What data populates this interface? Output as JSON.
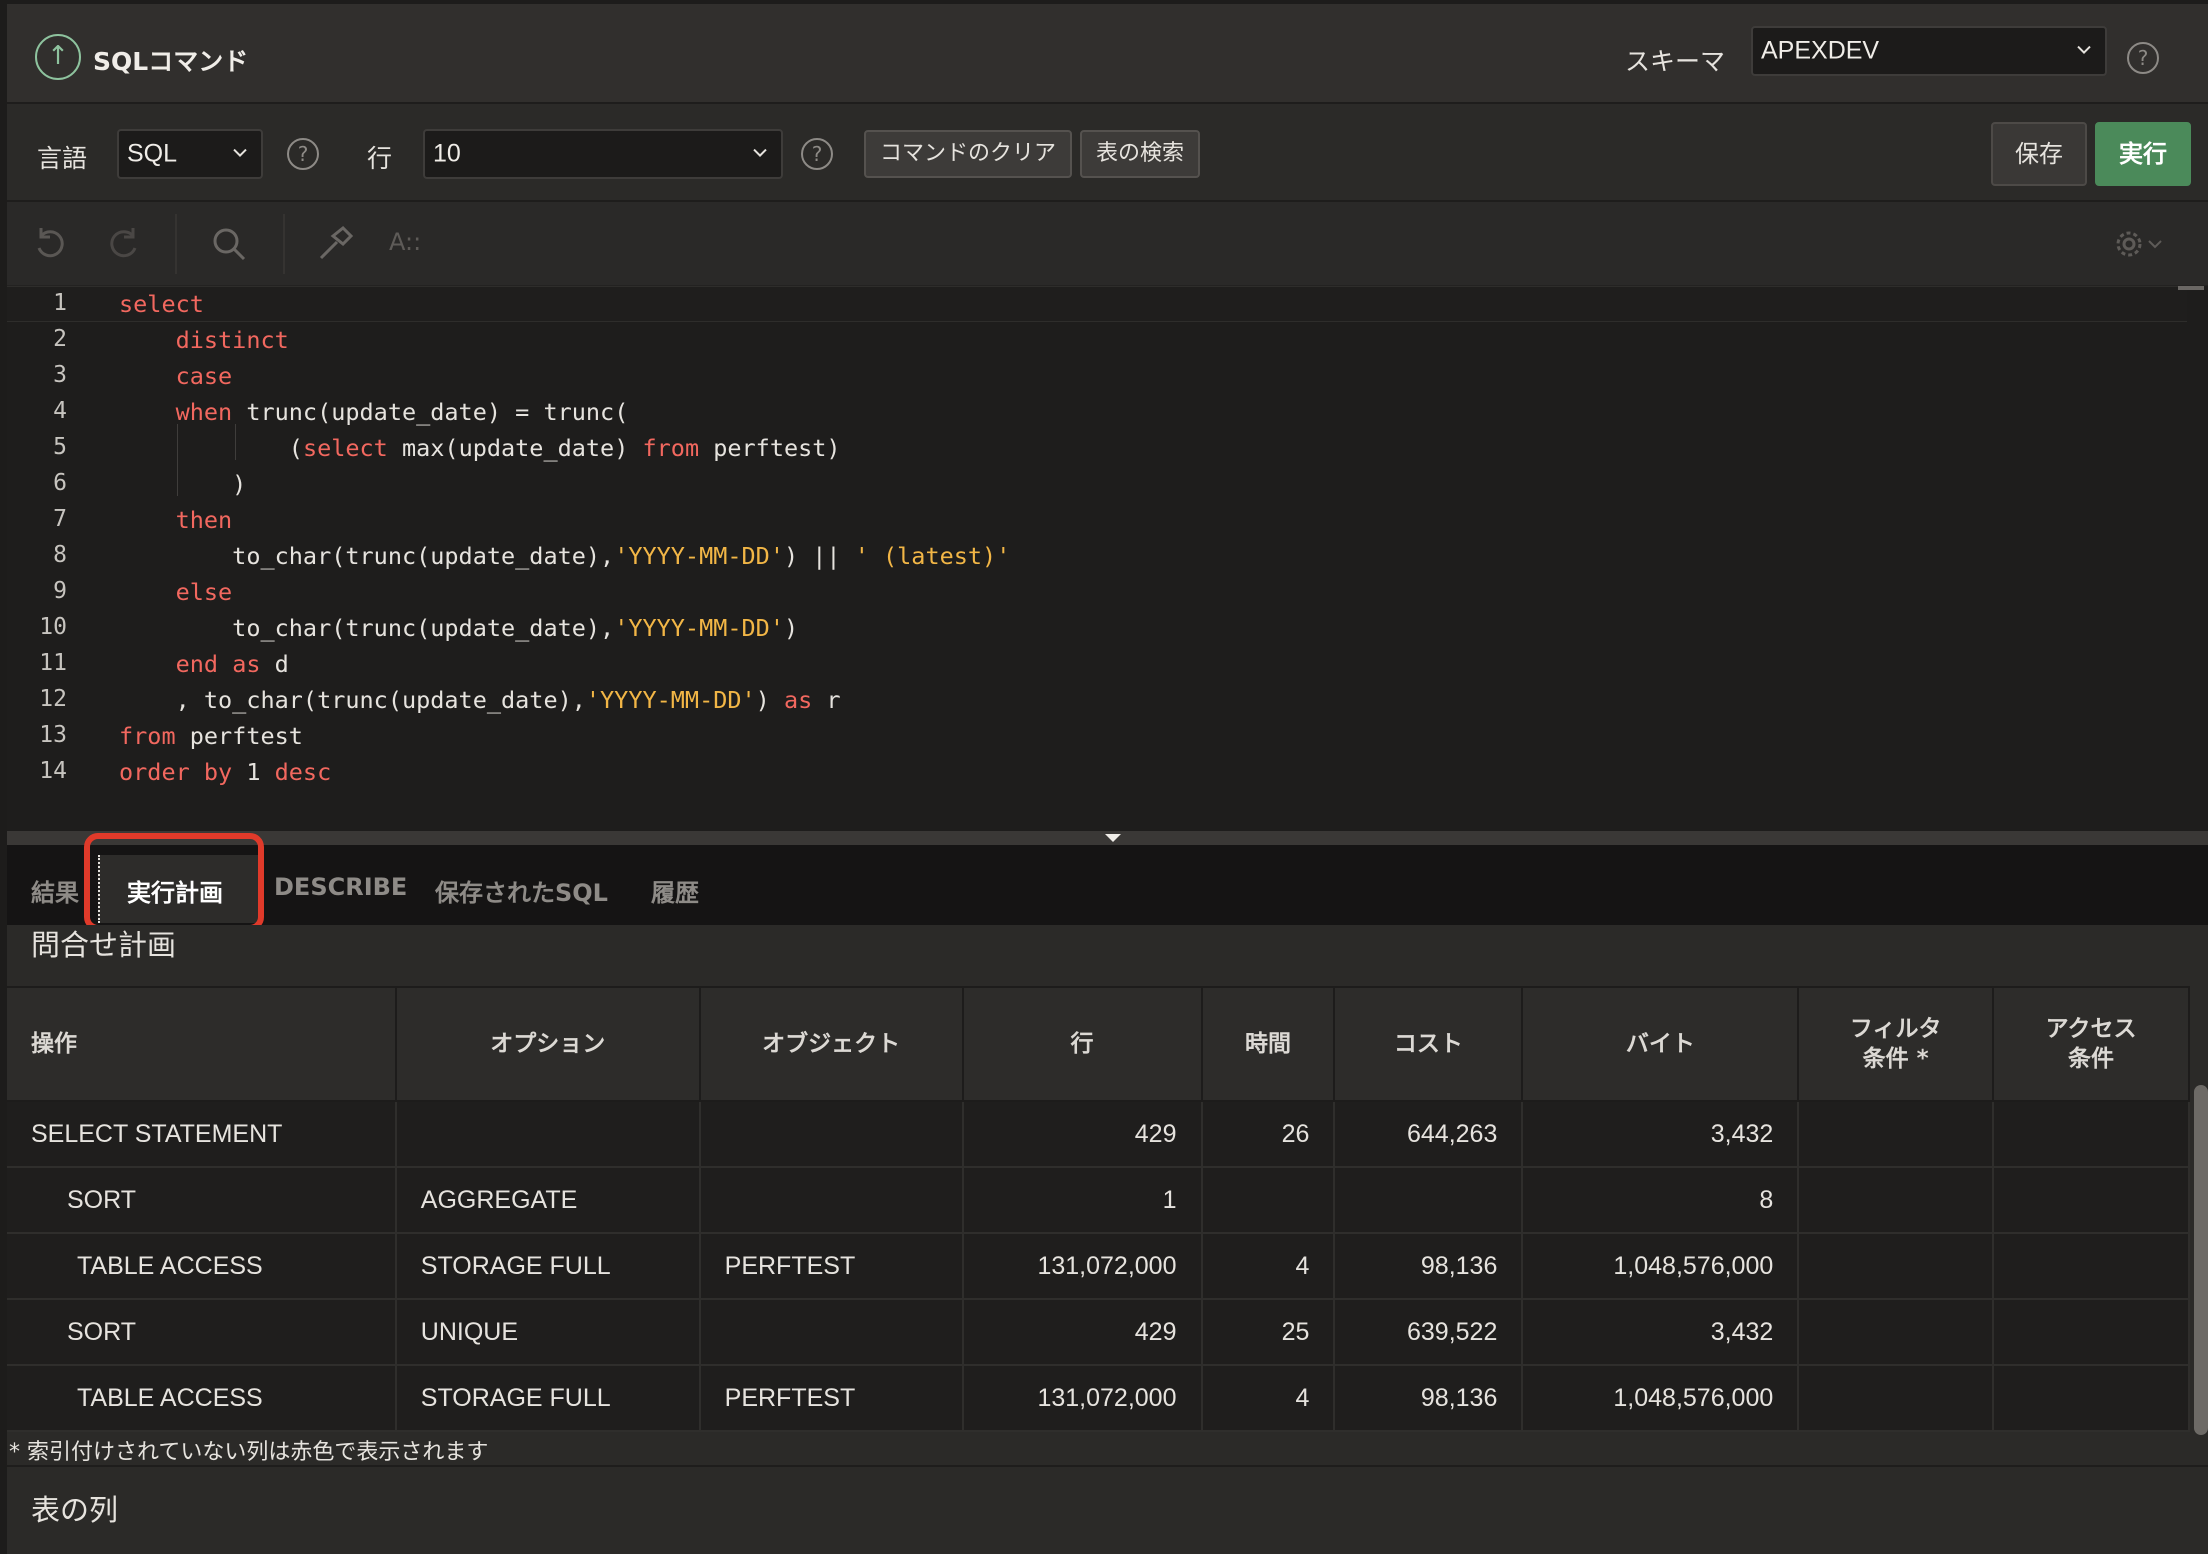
{
  "header": {
    "title": "SQLコマンド",
    "schema_label": "スキーマ",
    "schema_value": "APEXDEV"
  },
  "toolbar": {
    "language_label": "言語",
    "language_value": "SQL",
    "rows_label": "行",
    "rows_value": "10",
    "clear_label": "コマンドのクリア",
    "find_tables_label": "表の検索",
    "save_label": "保存",
    "run_label": "実行"
  },
  "editor_toolbar": {
    "text_size_label": "A::"
  },
  "editor": {
    "line_numbers": [
      "1",
      "2",
      "3",
      "4",
      "5",
      "6",
      "7",
      "8",
      "9",
      "10",
      "11",
      "12",
      "13",
      "14"
    ]
  },
  "tabs": {
    "results": "結果",
    "explain": "実行計画",
    "describe": "DESCRIBE",
    "saved_sql": "保存されたSQL",
    "history": "履歴"
  },
  "plan": {
    "title": "問合せ計画",
    "columns": [
      "操作",
      "オプション",
      "オブジェクト",
      "行",
      "時間",
      "コスト",
      "バイト",
      "フィルタ\n条件 *",
      "アクセス\n条件"
    ],
    "rows": [
      {
        "op": "SELECT STATEMENT",
        "option": "",
        "object": "",
        "rows": "429",
        "time": "26",
        "cost": "644,263",
        "bytes": "3,432"
      },
      {
        "op": "SORT",
        "option": "AGGREGATE",
        "object": "",
        "rows": "1",
        "time": "",
        "cost": "",
        "bytes": "8"
      },
      {
        "op": "TABLE ACCESS",
        "option": "STORAGE FULL",
        "object": "PERFTEST",
        "rows": "131,072,000",
        "time": "4",
        "cost": "98,136",
        "bytes": "1,048,576,000"
      },
      {
        "op": "SORT",
        "option": "UNIQUE",
        "object": "",
        "rows": "429",
        "time": "25",
        "cost": "639,522",
        "bytes": "3,432"
      },
      {
        "op": "TABLE ACCESS",
        "option": "STORAGE FULL",
        "object": "PERFTEST",
        "rows": "131,072,000",
        "time": "4",
        "cost": "98,136",
        "bytes": "1,048,576,000"
      }
    ],
    "footnote": "* 索引付けされていない列は赤色で表示されます",
    "columns_section_title": "表の列"
  },
  "colors": {
    "keyword": "#f2685f",
    "string": "#f2b646",
    "run_button": "#4b8a5a",
    "highlight_box": "#e03a2a",
    "object_text": "#f2b646"
  },
  "icons": [
    "upload-circle-icon",
    "chevron-down-icon",
    "help-icon",
    "undo-icon",
    "redo-icon",
    "search-icon",
    "hammer-icon",
    "gear-icon"
  ]
}
